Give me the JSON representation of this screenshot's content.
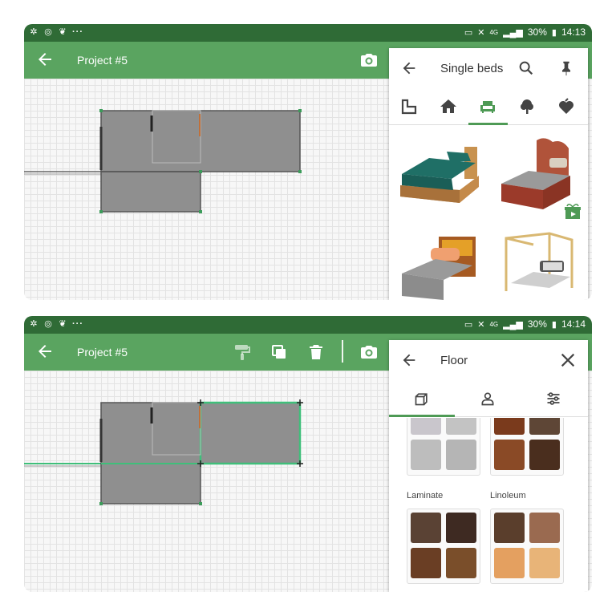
{
  "status_bar": {
    "top": {
      "battery": "30%",
      "time": "14:13",
      "network": "4G"
    },
    "bottom": {
      "battery": "30%",
      "time": "14:14",
      "network": "4G"
    },
    "more": "···"
  },
  "app": {
    "project_title": "Project #5"
  },
  "top_screen": {
    "panel": {
      "title": "Single beds",
      "tabs": [
        "room-outline",
        "house",
        "furniture",
        "tree",
        "favorite"
      ],
      "selected_tab": "furniture",
      "items": [
        "bed-teal",
        "bed-ornate",
        "bed-orange-pillow",
        "bed-canopy"
      ]
    }
  },
  "bottom_screen": {
    "panel": {
      "title": "Floor",
      "tabs": [
        "materials",
        "person",
        "sliders"
      ],
      "selected_tab": "materials",
      "categories": [
        {
          "label": ""
        },
        {
          "label": ""
        },
        {
          "label": "Laminate"
        },
        {
          "label": "Linoleum"
        }
      ]
    }
  },
  "colors": {
    "status_bar": "#2f6b36",
    "app_bar": "#5aa460",
    "accent": "#4e9a55",
    "room_fill": "#8f8f8f",
    "grid": "#e3e3e3"
  }
}
